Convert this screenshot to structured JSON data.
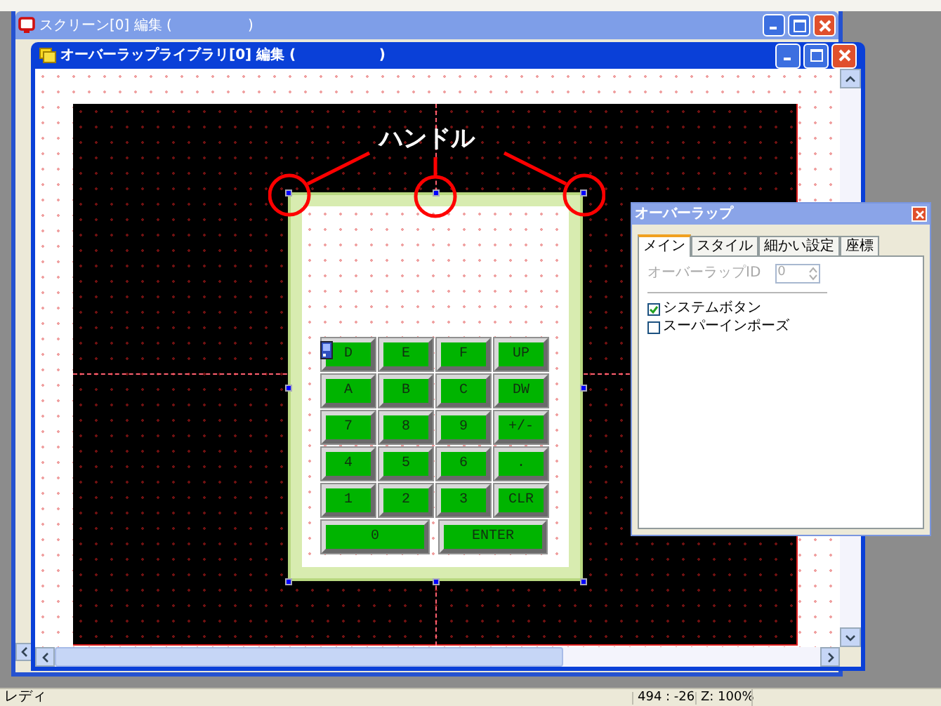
{
  "outer_window": {
    "title": "スクリーン[0] 編集 (                 )"
  },
  "inner_window": {
    "title": "オーバーラップライブラリ[0] 編集 (                 )"
  },
  "annotation": {
    "label": "ハンドル"
  },
  "keypad": {
    "rows": [
      [
        "D",
        "E",
        "F",
        "UP"
      ],
      [
        "A",
        "B",
        "C",
        "DW"
      ],
      [
        "7",
        "8",
        "9",
        "+/-"
      ],
      [
        "4",
        "5",
        "6",
        "."
      ],
      [
        "1",
        "2",
        "3",
        "CLR"
      ],
      [
        "0",
        "ENTER"
      ]
    ]
  },
  "dialog": {
    "title": "オーバーラップ",
    "tabs": [
      {
        "label": "メイン",
        "selected": true
      },
      {
        "label": "スタイル",
        "selected": false
      },
      {
        "label": "細かい設定",
        "selected": false
      },
      {
        "label": "座標",
        "selected": false
      }
    ],
    "id_field": {
      "label": "オーバーラップID",
      "value": "0",
      "disabled": true
    },
    "options": [
      {
        "label": "システムボタン",
        "checked": true
      },
      {
        "label": "スーパーインポーズ",
        "checked": false
      }
    ]
  },
  "status_bar": {
    "message": "レディ",
    "coords": "494 : -26",
    "zoom": "Z: 100%"
  }
}
